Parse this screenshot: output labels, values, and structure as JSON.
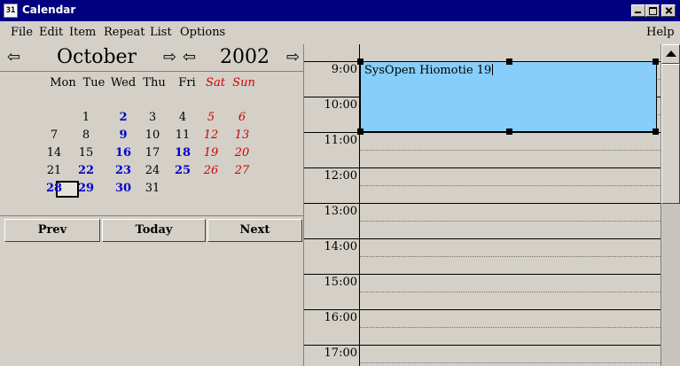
{
  "window": {
    "title": "Calendar",
    "icon_label": "31"
  },
  "menubar": {
    "items": [
      "File",
      "Edit",
      "Item",
      "Repeat",
      "List",
      "Options"
    ],
    "help": "Help"
  },
  "calendar": {
    "month": "October",
    "year": "2002",
    "weekdays": [
      "Mon",
      "Tue",
      "Wed",
      "Thu",
      "Fri",
      "Sat",
      "Sun"
    ],
    "weeks": [
      [
        "",
        "1",
        "2",
        "3",
        "4",
        "5",
        "6"
      ],
      [
        "7",
        "8",
        "9",
        "10",
        "11",
        "12",
        "13"
      ],
      [
        "14",
        "15",
        "16",
        "17",
        "18",
        "19",
        "20"
      ],
      [
        "21",
        "22",
        "23",
        "24",
        "25",
        "26",
        "27"
      ],
      [
        "28",
        "29",
        "30",
        "31",
        "",
        "",
        ""
      ]
    ],
    "highlighted_days": [
      "2",
      "9",
      "16",
      "18",
      "22",
      "23",
      "25",
      "28",
      "29",
      "30"
    ],
    "today": "28",
    "colors": {
      "weekend": "#cc0000",
      "event_day": "#0000cc"
    }
  },
  "buttons": {
    "prev": "Prev",
    "today": "Today",
    "next": "Next"
  },
  "day_view": {
    "hours": [
      "9:00",
      "10:00",
      "11:00",
      "12:00",
      "13:00",
      "14:00",
      "15:00",
      "16:00",
      "17:00"
    ],
    "appointment": {
      "text": "SysOpen Hiomotie 19",
      "color": "#87cefa"
    }
  }
}
